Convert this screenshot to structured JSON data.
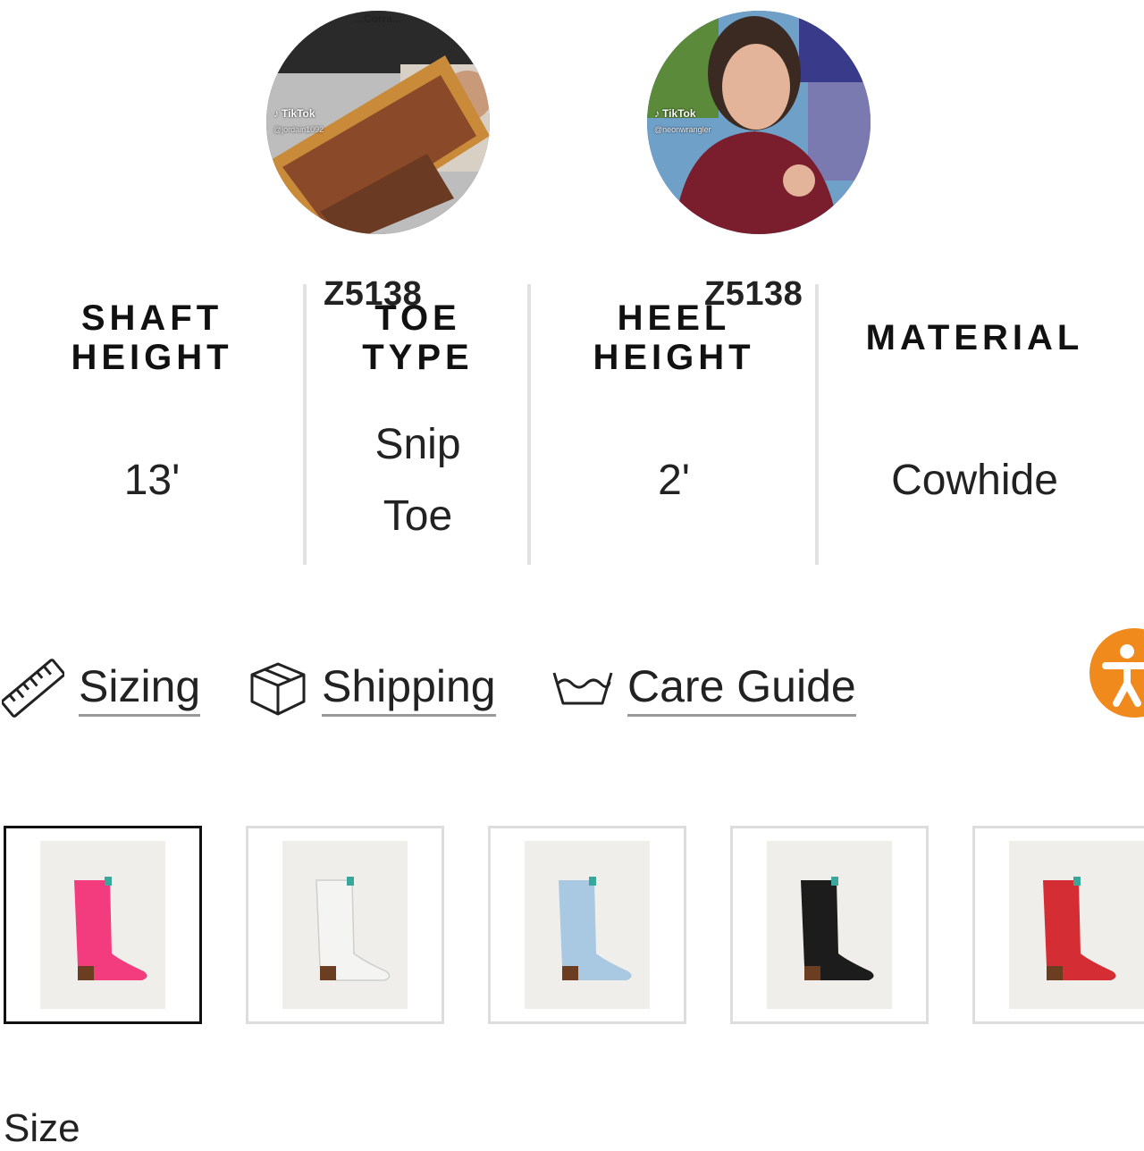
{
  "videos": [
    {
      "platform": "TikTok",
      "handle": "@jordain1092",
      "caption": "...Corra..."
    },
    {
      "platform": "TikTok",
      "handle": "@neonwrangler"
    }
  ],
  "product_codes": [
    "Z5138",
    "Z5138"
  ],
  "specs": [
    {
      "label_lines": [
        "SHAFT",
        "HEIGHT"
      ],
      "value_lines": [
        "13'"
      ]
    },
    {
      "label_lines": [
        "TOE",
        "TYPE"
      ],
      "value_lines": [
        "Snip",
        "Toe"
      ]
    },
    {
      "label_lines": [
        "HEEL",
        "HEIGHT"
      ],
      "value_lines": [
        "2'"
      ]
    },
    {
      "label_lines": [
        "MATERIAL"
      ],
      "value_lines": [
        "Cowhide"
      ]
    }
  ],
  "links": {
    "sizing": {
      "label": "Sizing",
      "icon": "ruler-icon"
    },
    "shipping": {
      "label": "Shipping",
      "icon": "box-icon"
    },
    "care": {
      "label": "Care Guide",
      "icon": "wash-basin-icon"
    }
  },
  "accessibility": {
    "icon": "accessibility-icon",
    "color": "#f18a1c"
  },
  "color_variants": [
    {
      "name": "pink",
      "color": "#f23c7e",
      "selected": true
    },
    {
      "name": "white",
      "color": "#f4f4f2",
      "selected": false
    },
    {
      "name": "light-blue",
      "color": "#a9c8e2",
      "selected": false
    },
    {
      "name": "black",
      "color": "#1c1c1c",
      "selected": false
    },
    {
      "name": "red",
      "color": "#d42e34",
      "selected": false
    }
  ],
  "size_label": "Size"
}
